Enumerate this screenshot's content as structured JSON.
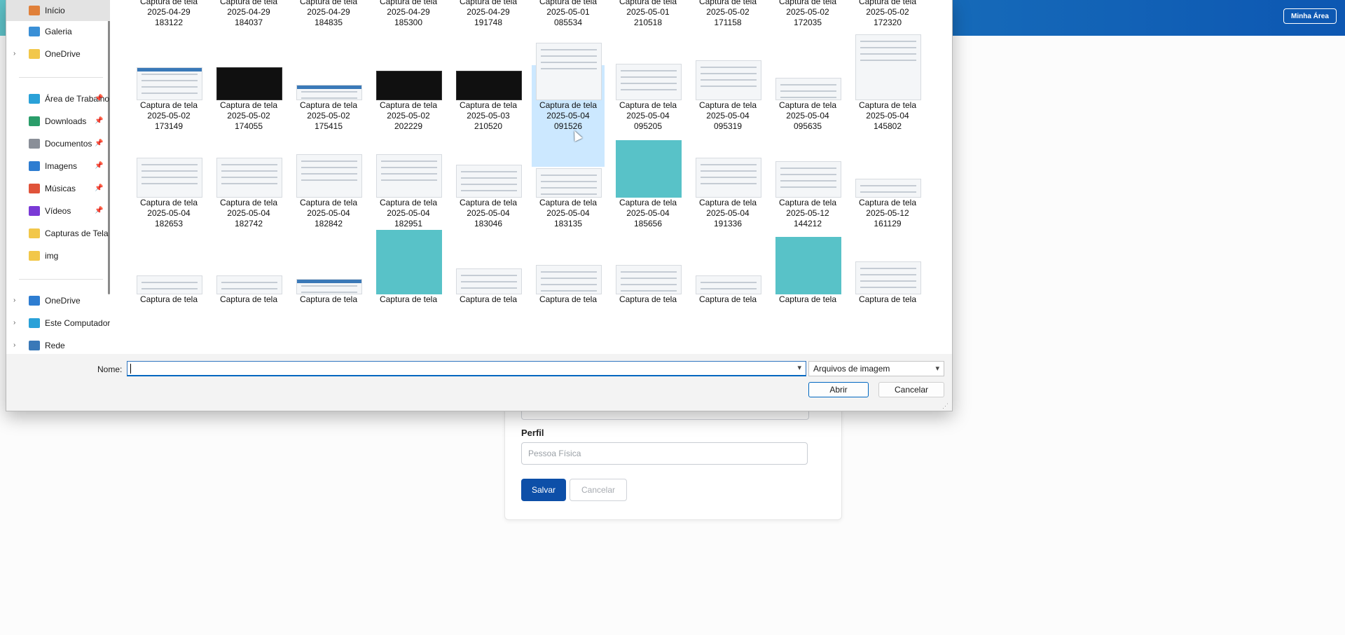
{
  "app": {
    "header_button": "Minha Área",
    "form": {
      "perfil_label": "Perfil",
      "perfil_value": "Pessoa Física",
      "save_label": "Salvar",
      "cancel_label": "Cancelar"
    }
  },
  "dialog": {
    "nav": [
      {
        "label": "Início",
        "icon": "home-icon",
        "color": "#e0803a",
        "chevron": false,
        "pinned": false,
        "active": true
      },
      {
        "label": "Galeria",
        "icon": "gallery-icon",
        "color": "#3a8fd6",
        "chevron": false,
        "pinned": false
      },
      {
        "label": "OneDrive",
        "icon": "folder-icon",
        "color": "#f2c74a",
        "chevron": true,
        "pinned": false
      },
      {
        "label": "Área de Trabalho",
        "icon": "desktop-icon",
        "color": "#2aa1d8",
        "chevron": false,
        "pinned": true
      },
      {
        "label": "Downloads",
        "icon": "download-icon",
        "color": "#2a9d6a",
        "chevron": false,
        "pinned": true
      },
      {
        "label": "Documentos",
        "icon": "document-icon",
        "color": "#8a8f98",
        "chevron": false,
        "pinned": true
      },
      {
        "label": "Imagens",
        "icon": "pictures-icon",
        "color": "#2e7dd1",
        "chevron": false,
        "pinned": true
      },
      {
        "label": "Músicas",
        "icon": "music-icon",
        "color": "#e0533a",
        "chevron": false,
        "pinned": true
      },
      {
        "label": "Vídeos",
        "icon": "videos-icon",
        "color": "#7a3ad6",
        "chevron": false,
        "pinned": true
      },
      {
        "label": "Capturas de Tela",
        "icon": "folder-icon",
        "color": "#f2c74a",
        "chevron": false,
        "pinned": false
      },
      {
        "label": "img",
        "icon": "folder-icon",
        "color": "#f2c74a",
        "chevron": false,
        "pinned": false
      },
      {
        "label": "OneDrive",
        "icon": "cloud-icon",
        "color": "#2e7dd1",
        "chevron": true,
        "pinned": false
      },
      {
        "label": "Este Computador",
        "icon": "computer-icon",
        "color": "#2aa1d8",
        "chevron": true,
        "pinned": false
      },
      {
        "label": "Rede",
        "icon": "network-icon",
        "color": "#3a79b8",
        "chevron": true,
        "pinned": false
      }
    ],
    "rows": [
      [
        {
          "name": "Captura de tela",
          "date": "2025-04-29",
          "time": "183122"
        },
        {
          "name": "Captura de tela",
          "date": "2025-04-29",
          "time": "184037"
        },
        {
          "name": "Captura de tela",
          "date": "2025-04-29",
          "time": "184835"
        },
        {
          "name": "Captura de tela",
          "date": "2025-04-29",
          "time": "185300"
        },
        {
          "name": "Captura de tela",
          "date": "2025-04-29",
          "time": "191748"
        },
        {
          "name": "Captura de tela",
          "date": "2025-05-01",
          "time": "085534"
        },
        {
          "name": "Captura de tela",
          "date": "2025-05-01",
          "time": "210518"
        },
        {
          "name": "Captura de tela",
          "date": "2025-05-02",
          "time": "171158"
        },
        {
          "name": "Captura de tela",
          "date": "2025-05-02",
          "time": "172035"
        },
        {
          "name": "Captura de tela",
          "date": "2025-05-02",
          "time": "172320"
        }
      ],
      [
        {
          "name": "Captura de tela",
          "date": "2025-05-02",
          "time": "173149"
        },
        {
          "name": "Captura de tela",
          "date": "2025-05-02",
          "time": "174055"
        },
        {
          "name": "Captura de tela",
          "date": "2025-05-02",
          "time": "175415"
        },
        {
          "name": "Captura de tela",
          "date": "2025-05-02",
          "time": "202229"
        },
        {
          "name": "Captura de tela",
          "date": "2025-05-03",
          "time": "210520"
        },
        {
          "name": "Captura de tela",
          "date": "2025-05-04",
          "time": "091526",
          "selected": true
        },
        {
          "name": "Captura de tela",
          "date": "2025-05-04",
          "time": "095205"
        },
        {
          "name": "Captura de tela",
          "date": "2025-05-04",
          "time": "095319"
        },
        {
          "name": "Captura de tela",
          "date": "2025-05-04",
          "time": "095635"
        },
        {
          "name": "Captura de tela",
          "date": "2025-05-04",
          "time": "145802"
        }
      ],
      [
        {
          "name": "Captura de tela",
          "date": "2025-05-04",
          "time": "182653"
        },
        {
          "name": "Captura de tela",
          "date": "2025-05-04",
          "time": "182742"
        },
        {
          "name": "Captura de tela",
          "date": "2025-05-04",
          "time": "182842"
        },
        {
          "name": "Captura de tela",
          "date": "2025-05-04",
          "time": "182951"
        },
        {
          "name": "Captura de tela",
          "date": "2025-05-04",
          "time": "183046"
        },
        {
          "name": "Captura de tela",
          "date": "2025-05-04",
          "time": "183135"
        },
        {
          "name": "Captura de tela",
          "date": "2025-05-04",
          "time": "185656"
        },
        {
          "name": "Captura de tela",
          "date": "2025-05-04",
          "time": "191336"
        },
        {
          "name": "Captura de tela",
          "date": "2025-05-12",
          "time": "144212"
        },
        {
          "name": "Captura de tela",
          "date": "2025-05-12",
          "time": "161129"
        }
      ],
      [
        {
          "name": "Captura de tela",
          "date": "",
          "time": ""
        },
        {
          "name": "Captura de tela",
          "date": "",
          "time": ""
        },
        {
          "name": "Captura de tela",
          "date": "",
          "time": ""
        },
        {
          "name": "Captura de tela",
          "date": "",
          "time": ""
        },
        {
          "name": "Captura de tela",
          "date": "",
          "time": ""
        },
        {
          "name": "Captura de tela",
          "date": "",
          "time": ""
        },
        {
          "name": "Captura de tela",
          "date": "",
          "time": ""
        },
        {
          "name": "Captura de tela",
          "date": "",
          "time": ""
        },
        {
          "name": "Captura de tela",
          "date": "",
          "time": ""
        },
        {
          "name": "Captura de tela",
          "date": "",
          "time": ""
        }
      ]
    ],
    "nome_label": "Nome:",
    "nome_value": "",
    "filter_label": "Arquivos de imagem",
    "open_label": "Abrir",
    "cancel_label": "Cancelar"
  }
}
